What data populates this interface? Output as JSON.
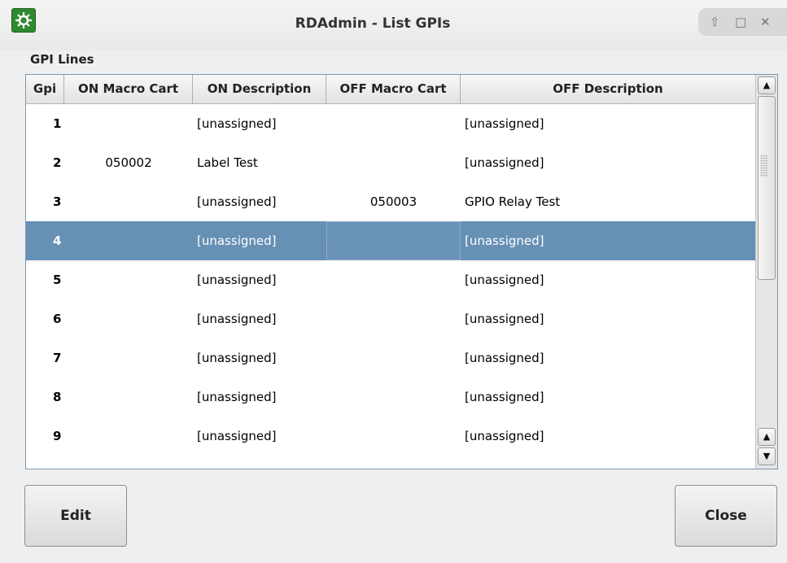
{
  "window": {
    "title": "RDAdmin - List GPIs",
    "app_icon": "rivendell-gear-icon",
    "controls": [
      "up-arrow-icon",
      "maximize-icon",
      "close-icon"
    ]
  },
  "section_label": "GPI Lines",
  "table": {
    "columns": [
      "Gpi",
      "ON Macro Cart",
      "ON Description",
      "OFF Macro Cart",
      "OFF Description"
    ],
    "rows": [
      {
        "gpi": "1",
        "on_cart": "",
        "on_desc": "[unassigned]",
        "off_cart": "",
        "off_desc": "[unassigned]"
      },
      {
        "gpi": "2",
        "on_cart": "050002",
        "on_desc": "Label Test",
        "off_cart": "",
        "off_desc": "[unassigned]"
      },
      {
        "gpi": "3",
        "on_cart": "",
        "on_desc": "[unassigned]",
        "off_cart": "050003",
        "off_desc": "GPIO Relay Test"
      },
      {
        "gpi": "4",
        "on_cart": "",
        "on_desc": "[unassigned]",
        "off_cart": "",
        "off_desc": "[unassigned]"
      },
      {
        "gpi": "5",
        "on_cart": "",
        "on_desc": "[unassigned]",
        "off_cart": "",
        "off_desc": "[unassigned]"
      },
      {
        "gpi": "6",
        "on_cart": "",
        "on_desc": "[unassigned]",
        "off_cart": "",
        "off_desc": "[unassigned]"
      },
      {
        "gpi": "7",
        "on_cart": "",
        "on_desc": "[unassigned]",
        "off_cart": "",
        "off_desc": "[unassigned]"
      },
      {
        "gpi": "8",
        "on_cart": "",
        "on_desc": "[unassigned]",
        "off_cart": "",
        "off_desc": "[unassigned]"
      },
      {
        "gpi": "9",
        "on_cart": "",
        "on_desc": "[unassigned]",
        "off_cart": "",
        "off_desc": "[unassigned]"
      }
    ],
    "selected_gpi": "4"
  },
  "buttons": {
    "edit_label": "Edit",
    "close_label": "Close"
  },
  "colors": {
    "selection": "#6690b4",
    "app_icon": "#2f8a2f"
  }
}
